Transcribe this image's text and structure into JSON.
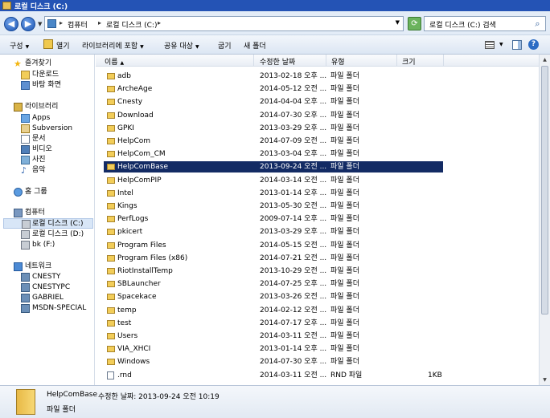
{
  "window": {
    "title": "로컬 디스크 (C:)"
  },
  "address": {
    "crumbs": [
      "컴퓨터",
      "로컬 디스크 (C:)"
    ],
    "search_placeholder": "로컬 디스크 (C:) 검색"
  },
  "toolbar": {
    "organize": "구성",
    "open": "열기",
    "include_library": "라이브러리에 포함",
    "share": "공유 대상",
    "burn": "굽기",
    "new_folder": "새 폴더"
  },
  "sidebar": {
    "favorites": {
      "label": "즐겨찾기",
      "items": [
        "다운로드",
        "바탕 화면"
      ]
    },
    "libraries": {
      "label": "라이브러리",
      "items": [
        "Apps",
        "Subversion",
        "문서",
        "비디오",
        "사진",
        "음악"
      ]
    },
    "homegroup": "홈 그룹",
    "computer": {
      "label": "컴퓨터",
      "items": [
        "로컬 디스크 (C:)",
        "로컬 디스크 (D:)",
        "bk (F:)"
      ]
    },
    "network": {
      "label": "네트워크",
      "items": [
        "CNESTY",
        "CNESTYPC",
        "GABRIEL",
        "MSDN-SPECIAL"
      ]
    }
  },
  "columns": {
    "name": "이름",
    "date": "수정한 날짜",
    "type": "유형",
    "size": "크기"
  },
  "files": [
    {
      "name": "adb",
      "date": "2013-02-18 오후 ...",
      "type": "파일 폴더",
      "size": ""
    },
    {
      "name": "ArcheAge",
      "date": "2014-05-12 오전 ...",
      "type": "파일 폴더",
      "size": ""
    },
    {
      "name": "Cnesty",
      "date": "2014-04-04 오후 ...",
      "type": "파일 폴더",
      "size": ""
    },
    {
      "name": "Download",
      "date": "2014-07-30 오후 ...",
      "type": "파일 폴더",
      "size": ""
    },
    {
      "name": "GPKI",
      "date": "2013-03-29 오후 ...",
      "type": "파일 폴더",
      "size": ""
    },
    {
      "name": "HelpCom",
      "date": "2014-07-09 오전 ...",
      "type": "파일 폴더",
      "size": ""
    },
    {
      "name": "HelpCom_CM",
      "date": "2013-03-04 오후 ...",
      "type": "파일 폴더",
      "size": ""
    },
    {
      "name": "HelpComBase",
      "date": "2013-09-24 오전 ...",
      "type": "파일 폴더",
      "size": ""
    },
    {
      "name": "HelpComPIP",
      "date": "2014-03-14 오전 ...",
      "type": "파일 폴더",
      "size": ""
    },
    {
      "name": "Intel",
      "date": "2013-01-14 오후 ...",
      "type": "파일 폴더",
      "size": ""
    },
    {
      "name": "Kings",
      "date": "2013-05-30 오전 ...",
      "type": "파일 폴더",
      "size": ""
    },
    {
      "name": "PerfLogs",
      "date": "2009-07-14 오후 ...",
      "type": "파일 폴더",
      "size": ""
    },
    {
      "name": "pkicert",
      "date": "2013-03-29 오후 ...",
      "type": "파일 폴더",
      "size": ""
    },
    {
      "name": "Program Files",
      "date": "2014-05-15 오전 ...",
      "type": "파일 폴더",
      "size": ""
    },
    {
      "name": "Program Files (x86)",
      "date": "2014-07-21 오전 ...",
      "type": "파일 폴더",
      "size": ""
    },
    {
      "name": "RiotInstallTemp",
      "date": "2013-10-29 오전 ...",
      "type": "파일 폴더",
      "size": ""
    },
    {
      "name": "SBLauncher",
      "date": "2014-07-25 오후 ...",
      "type": "파일 폴더",
      "size": ""
    },
    {
      "name": "Spacekace",
      "date": "2013-03-26 오전 ...",
      "type": "파일 폴더",
      "size": ""
    },
    {
      "name": "temp",
      "date": "2014-02-12 오전 ...",
      "type": "파일 폴더",
      "size": ""
    },
    {
      "name": "test",
      "date": "2014-07-17 오후 ...",
      "type": "파일 폴더",
      "size": ""
    },
    {
      "name": "Users",
      "date": "2014-03-11 오전 ...",
      "type": "파일 폴더",
      "size": ""
    },
    {
      "name": "VIA_XHCI",
      "date": "2013-01-14 오후 ...",
      "type": "파일 폴더",
      "size": ""
    },
    {
      "name": "Windows",
      "date": "2014-07-30 오후 ...",
      "type": "파일 폴더",
      "size": ""
    },
    {
      "name": ".rnd",
      "date": "2014-03-11 오전 ...",
      "type": "RND 파일",
      "size": "1KB"
    }
  ],
  "selected_index": 7,
  "details": {
    "name": "HelpComBase",
    "date_label": "수정한 날짜: 2013-09-24 오전 10:19",
    "type": "파일 폴더"
  },
  "colors": {
    "title_bar": "#2453b5",
    "selection": "#132b64",
    "folder": "#f2cd59"
  }
}
